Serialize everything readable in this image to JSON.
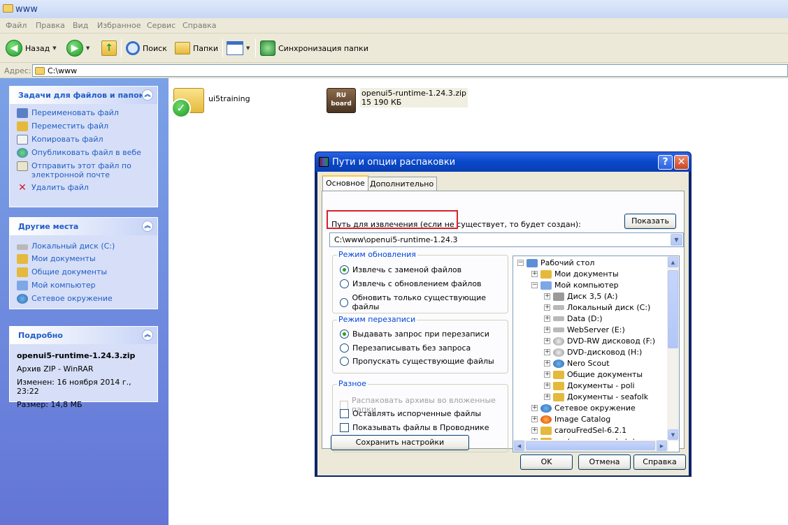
{
  "window": {
    "title": "www"
  },
  "menu": [
    "Файл",
    "Правка",
    "Вид",
    "Избранное",
    "Сервис",
    "Справка"
  ],
  "toolbar": {
    "back_label": "Назад",
    "search_label": "Поиск",
    "folders_label": "Папки",
    "sync_label": "Синхронизация папки"
  },
  "address": {
    "label": "Адрес:",
    "value": "C:\\www"
  },
  "tasks": {
    "title": "Задачи для файлов и папок",
    "items": [
      {
        "label": "Переименовать файл",
        "icon": "rename-icon"
      },
      {
        "label": "Переместить файл",
        "icon": "move-icon"
      },
      {
        "label": "Копировать файл",
        "icon": "copy-icon"
      },
      {
        "label": "Опубликовать файл в вебе",
        "icon": "web-publish-icon"
      },
      {
        "label": "Отправить этот файл по электронной почте",
        "icon": "email-icon"
      },
      {
        "label": "Удалить файл",
        "icon": "delete-icon"
      }
    ]
  },
  "other_places": {
    "title": "Другие места",
    "items": [
      {
        "label": "Локальный диск (C:)"
      },
      {
        "label": "Мои документы"
      },
      {
        "label": "Общие документы"
      },
      {
        "label": "Мой компьютер"
      },
      {
        "label": "Сетевое окружение"
      }
    ]
  },
  "details": {
    "title": "Подробно",
    "filename": "openui5-runtime-1.24.3.zip",
    "type": "Архив ZIP - WinRAR",
    "modified": "Изменен: 16 ноября 2014 г., 23:22",
    "size": "Размер: 14,8 МБ"
  },
  "files": [
    {
      "name": "ui5training",
      "kind": "folder"
    },
    {
      "name": "openui5-runtime-1.24.3.zip",
      "size": "15 190 КБ",
      "icon_text": "RU board",
      "kind": "archive"
    }
  ],
  "dialog": {
    "title": "Пути и опции распаковки",
    "tabs": [
      "Основное",
      "Дополнительно"
    ],
    "path_label": "Путь для извлечения (если не существует, то будет создан):",
    "show_button": "Показать",
    "path_value": "C:\\www\\openui5-runtime-1.24.3",
    "update_mode": {
      "title": "Режим обновления",
      "options": [
        "Извлечь с заменой файлов",
        "Извлечь с обновлением файлов",
        "Обновить только существующие файлы"
      ],
      "selected": 0
    },
    "overwrite_mode": {
      "title": "Режим перезаписи",
      "options": [
        "Выдавать запрос при перезаписи",
        "Перезаписывать без запроса",
        "Пропускать существующие файлы"
      ],
      "selected": 0
    },
    "misc": {
      "title": "Разное",
      "options": [
        {
          "label": "Распаковать архивы во вложенные папки",
          "checked": false,
          "disabled": true
        },
        {
          "label": "Оставлять испорченные файлы",
          "checked": false,
          "disabled": false
        },
        {
          "label": "Показывать файлы в Проводнике",
          "checked": false,
          "disabled": false
        }
      ]
    },
    "save_button": "Сохранить настройки",
    "tree": [
      {
        "label": "Рабочий стол",
        "level": 0,
        "expander": "−"
      },
      {
        "label": "Мои документы",
        "level": 1,
        "expander": "+"
      },
      {
        "label": "Мой компьютер",
        "level": 1,
        "expander": "−"
      },
      {
        "label": "Диск 3,5 (A:)",
        "level": 2,
        "expander": "+"
      },
      {
        "label": "Локальный диск (C:)",
        "level": 2,
        "expander": "+"
      },
      {
        "label": "Data (D:)",
        "level": 2,
        "expander": "+"
      },
      {
        "label": "WebServer (E:)",
        "level": 2,
        "expander": "+"
      },
      {
        "label": "DVD-RW дисковод (F:)",
        "level": 2,
        "expander": "+"
      },
      {
        "label": "DVD-дисковод (H:)",
        "level": 2,
        "expander": "+"
      },
      {
        "label": "Nero Scout",
        "level": 2,
        "expander": "+"
      },
      {
        "label": "Общие документы",
        "level": 2,
        "expander": "+"
      },
      {
        "label": "Документы - poli",
        "level": 2,
        "expander": "+"
      },
      {
        "label": "Документы - seafolk",
        "level": 2,
        "expander": "+"
      },
      {
        "label": "Сетевое окружение",
        "level": 1,
        "expander": "+"
      },
      {
        "label": "Image Catalog",
        "level": 1,
        "expander": "+"
      },
      {
        "label": "carouFredSel-6.2.1",
        "level": 1,
        "expander": "+"
      },
      {
        "label": "customer_sample.txt",
        "level": 1,
        "expander": "+"
      }
    ],
    "ok_button": "OK",
    "cancel_button": "Отмена",
    "help_button": "Справка"
  }
}
